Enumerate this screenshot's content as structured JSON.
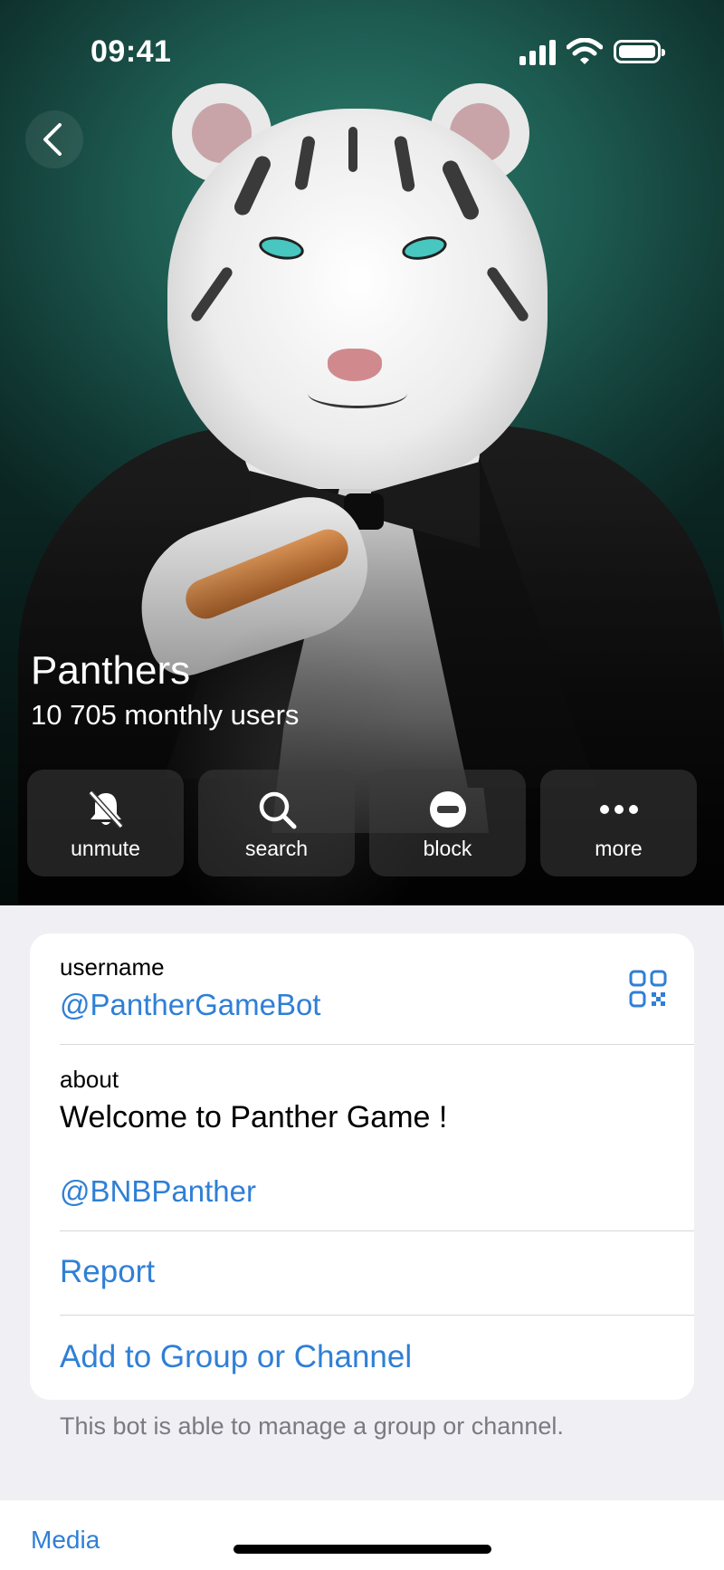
{
  "status_bar": {
    "time": "09:41"
  },
  "header": {
    "title": "Panthers",
    "subtitle": "10 705 monthly users"
  },
  "actions": [
    {
      "label": "unmute",
      "icon": "bell-slash-icon"
    },
    {
      "label": "search",
      "icon": "search-icon"
    },
    {
      "label": "block",
      "icon": "block-icon"
    },
    {
      "label": "more",
      "icon": "ellipsis-icon"
    }
  ],
  "info": {
    "username_label": "username",
    "username_value": "@PantherGameBot",
    "about_label": "about",
    "about_text": "Welcome to Panther Game !",
    "about_link": "@BNBPanther",
    "report": "Report",
    "add_to_group": "Add to Group or Channel"
  },
  "footnote": "This bot is able to manage a group or channel.",
  "tabs": {
    "media": "Media"
  },
  "colors": {
    "link": "#2f7fd6",
    "hero_bg": "#1d5a50",
    "page_bg": "#efeff4"
  }
}
